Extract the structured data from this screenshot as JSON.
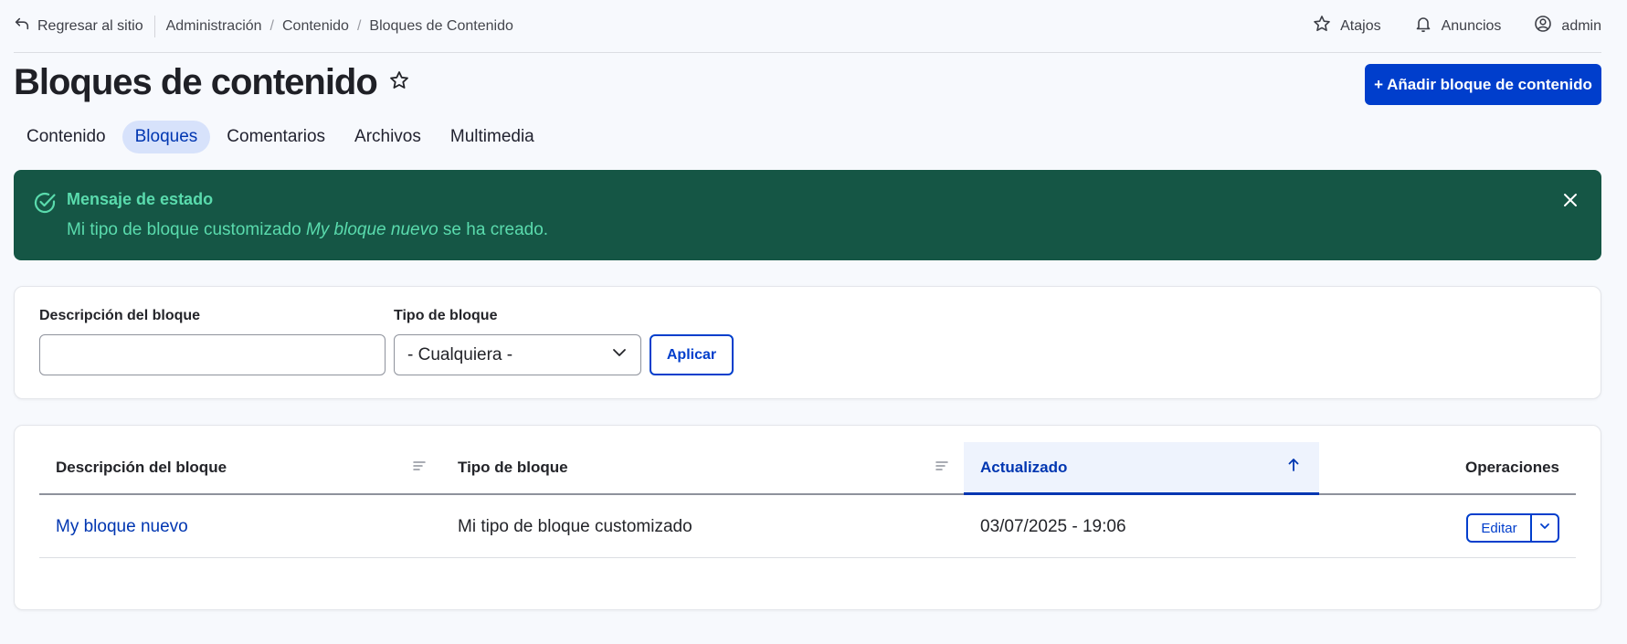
{
  "topbar": {
    "back_label": "Regresar al sitio",
    "breadcrumbs": [
      "Administración",
      "Contenido",
      "Bloques de Contenido"
    ],
    "shortcuts_label": "Atajos",
    "announcements_label": "Anuncios",
    "user_label": "admin"
  },
  "header": {
    "title": "Bloques de contenido",
    "add_button_label": "+ Añadir bloque de contenido"
  },
  "tabs": [
    {
      "label": "Contenido",
      "active": false
    },
    {
      "label": "Bloques",
      "active": true
    },
    {
      "label": "Comentarios",
      "active": false
    },
    {
      "label": "Archivos",
      "active": false
    },
    {
      "label": "Multimedia",
      "active": false
    }
  ],
  "status": {
    "title": "Mensaje de estado",
    "message_prefix": "Mi tipo de bloque customizado ",
    "message_emphasis": "My bloque nuevo",
    "message_suffix": " se ha creado."
  },
  "filter": {
    "description_label": "Descripción del bloque",
    "description_value": "",
    "type_label": "Tipo de bloque",
    "type_selected": "- Cualquiera -",
    "apply_label": "Aplicar"
  },
  "table": {
    "columns": {
      "description": "Descripción del bloque",
      "type": "Tipo de bloque",
      "updated": "Actualizado",
      "operations": "Operaciones"
    },
    "rows": [
      {
        "description": "My bloque nuevo",
        "type": "Mi tipo de bloque customizado",
        "updated": "03/07/2025 - 19:06",
        "edit_label": "Editar"
      }
    ]
  },
  "colors": {
    "primary": "#003ecc",
    "status_bg": "#155645",
    "status_text": "#5adbad",
    "active_tab_bg": "#d7e2fb"
  }
}
